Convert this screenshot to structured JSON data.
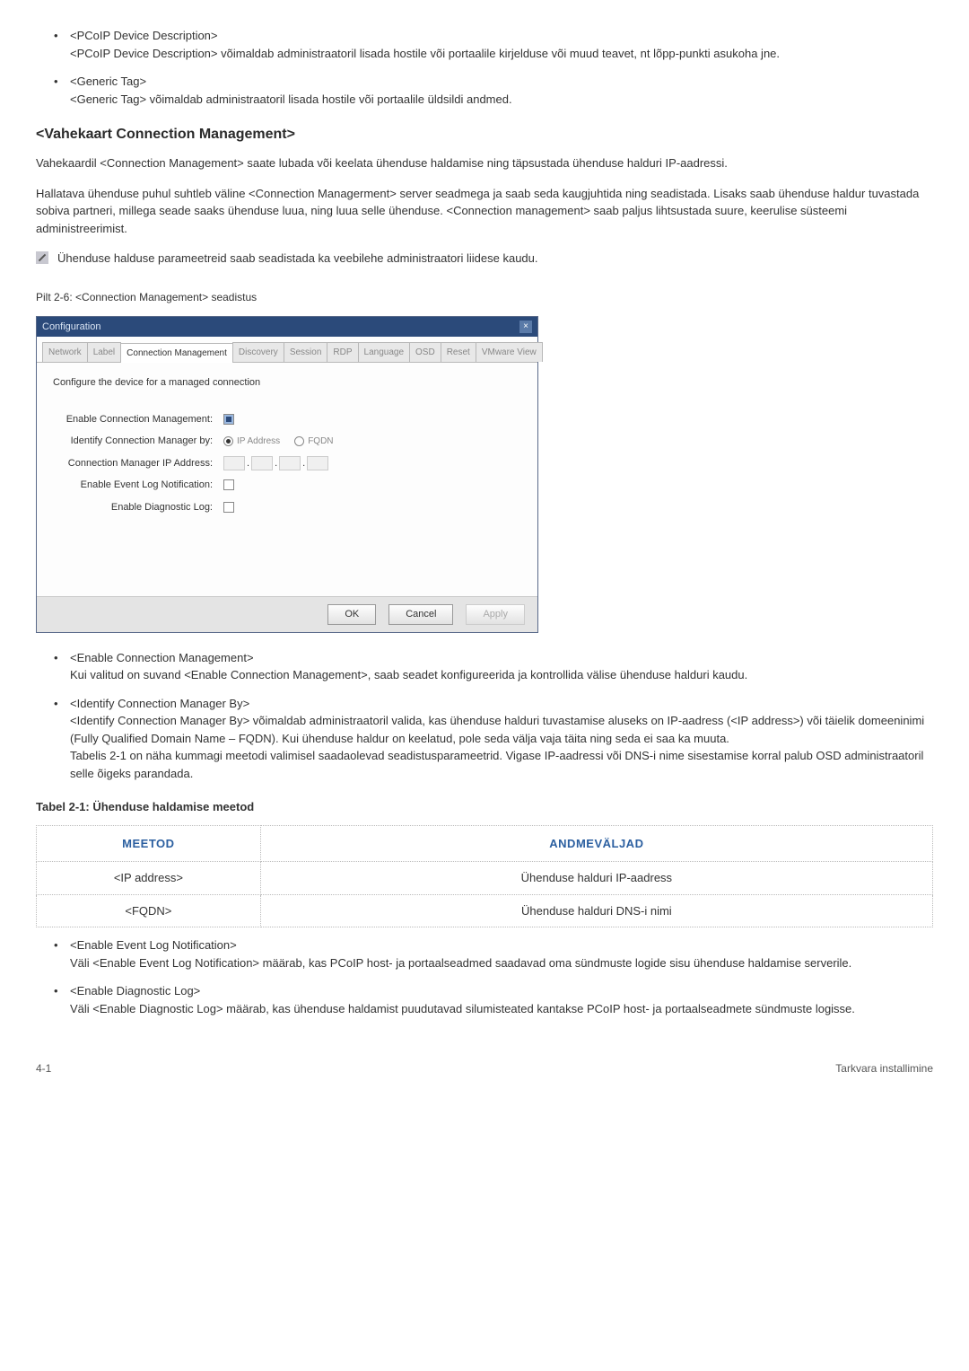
{
  "top_list": [
    {
      "title": "<PCoIP Device Description>",
      "body": "<PCoIP Device Description> võimaldab administraatoril lisada hostile või portaalile kirjelduse või muud teavet, nt lõpp-punkti asukoha jne."
    },
    {
      "title": "<Generic Tag>",
      "body": "<Generic Tag> võimaldab administraatoril lisada hostile või portaalile üldsildi andmed."
    }
  ],
  "section_heading": "<Vahekaart Connection Management>",
  "section_p1": "Vahekaardil <Connection Management> saate lubada või keelata ühenduse haldamise ning täpsustada ühenduse halduri IP-aadressi.",
  "section_p2": "Hallatava ühenduse puhul suhtleb väline <Connection Managerment> server seadmega ja saab seda kaugjuhtida ning seadistada. Lisaks saab ühenduse haldur tuvastada sobiva partneri, millega seade saaks ühenduse luua, ning luua selle ühenduse. <Connection management> saab paljus lihtsustada suure, keerulise süsteemi administreerimist.",
  "note_text": "Ühenduse halduse parameetreid saab seadistada ka veebilehe administraatori liidese kaudu.",
  "fig_caption": "Pilt 2-6: <Connection Management> seadistus",
  "dialog": {
    "title": "Configuration",
    "tabs": [
      "Network",
      "Label",
      "Connection Management",
      "Discovery",
      "Session",
      "RDP",
      "Language",
      "OSD",
      "Reset",
      "VMware View"
    ],
    "active_tab_index": 2,
    "intro": "Configure the device for a managed connection",
    "labels": {
      "enable_cm": "Enable Connection Management:",
      "identify_by": "Identify Connection Manager by:",
      "cm_ip": "Connection Manager IP Address:",
      "event_log": "Enable Event Log Notification:",
      "diag_log": "Enable Diagnostic Log:"
    },
    "radio_ip": "IP Address",
    "radio_fqdn": "FQDN",
    "buttons": {
      "ok": "OK",
      "cancel": "Cancel",
      "apply": "Apply"
    }
  },
  "after_list": [
    {
      "title": "<Enable Connection Management>",
      "body": "Kui valitud on suvand <Enable Connection Management>, saab seadet konfigureerida ja kontrollida välise ühenduse halduri kaudu."
    },
    {
      "title": "<Identify Connection Manager By>",
      "body": "<Identify Connection Manager By> võimaldab administraatoril valida, kas ühenduse halduri tuvastamise aluseks on IP-aadress (<IP address>) või täielik domeeninimi (Fully Qualified Domain Name – FQDN). Kui ühenduse haldur on keelatud, pole seda välja vaja täita ning seda ei saa ka muuta.",
      "body2": "Tabelis 2-1 on näha kummagi meetodi valimisel saadaolevad seadistusparameetrid. Vigase IP-aadressi või DNS-i nime sisestamise korral palub OSD administraatoril selle õigeks parandada."
    }
  ],
  "table_caption": "Tabel 2-1: Ühenduse haldamise meetod",
  "table": {
    "headers": {
      "method": "MEETOD",
      "fields": "ANDMEVÄLJAD"
    },
    "rows": [
      {
        "method": "<IP address>",
        "fields": "Ühenduse halduri IP-aadress"
      },
      {
        "method": "<FQDN>",
        "fields": "Ühenduse halduri DNS-i nimi"
      }
    ]
  },
  "final_list": [
    {
      "title": "<Enable Event Log Notification>",
      "body": "Väli <Enable Event Log Notification> määrab, kas PCoIP host- ja portaalseadmed saadavad oma sündmuste logide sisu ühenduse haldamise serverile."
    },
    {
      "title": "<Enable Diagnostic Log>",
      "body": "Väli <Enable Diagnostic Log> määrab, kas ühenduse haldamist puudutavad silumisteated kantakse PCoIP host- ja portaalseadmete sündmuste logisse."
    }
  ],
  "footer": {
    "left": "4-1",
    "right": "Tarkvara installimine"
  }
}
